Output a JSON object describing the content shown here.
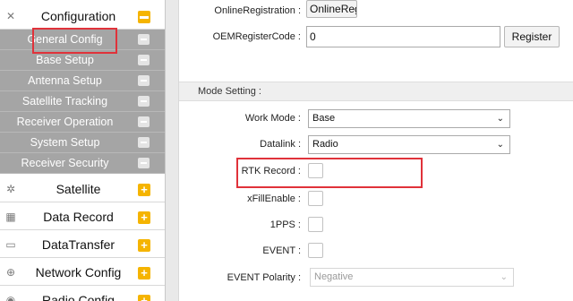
{
  "sidebar": {
    "top_items": [
      {
        "label": "Configuration",
        "icon": "tools-icon",
        "expanded": true
      },
      {
        "label": "Satellite",
        "icon": "satellite-icon"
      },
      {
        "label": "Data Record",
        "icon": "calendar-icon"
      },
      {
        "label": "DataTransfer",
        "icon": "transfer-icon"
      },
      {
        "label": "Network Config",
        "icon": "globe-icon"
      },
      {
        "label": "Radio Config",
        "icon": "radio-icon"
      }
    ],
    "sub_items": [
      {
        "label": "General Config"
      },
      {
        "label": "Base Setup"
      },
      {
        "label": "Antenna Setup"
      },
      {
        "label": "Satellite Tracking"
      },
      {
        "label": "Receiver Operation"
      },
      {
        "label": "System Setup"
      },
      {
        "label": "Receiver Security"
      }
    ]
  },
  "main": {
    "online_registration": {
      "label": "OnlineRegistration :",
      "value": "OnlineRegi"
    },
    "oem_register_code": {
      "label": "OEMRegisterCode :",
      "value": "0",
      "button": "Register"
    },
    "mode_setting": {
      "title": "Mode Setting :"
    },
    "work_mode": {
      "label": "Work Mode :",
      "value": "Base"
    },
    "datalink": {
      "label": "Datalink :",
      "value": "Radio"
    },
    "rtk_record": {
      "label": "RTK Record :"
    },
    "xfill_enable": {
      "label": "xFillEnable :"
    },
    "pps": {
      "label": "1PPS :"
    },
    "event": {
      "label": "EVENT :"
    },
    "event_polarity": {
      "label": "EVENT Polarity :",
      "value": "Negative"
    }
  },
  "colors": {
    "accent": "#f5b400",
    "highlight": "#e0323a",
    "submenu_bg": "#a5a5a5"
  }
}
